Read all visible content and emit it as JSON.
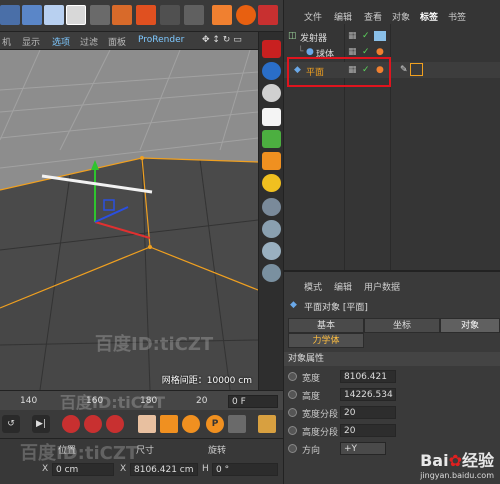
{
  "viewport_menu": {
    "items": [
      "机",
      "显示",
      "选项",
      "过滤",
      "面板",
      "ProRender"
    ]
  },
  "viewport": {
    "grid_label": "网格间距：10000 cm"
  },
  "object_manager": {
    "menu": [
      "文件",
      "编辑",
      "查看",
      "对象",
      "标签",
      "书签"
    ],
    "rows": [
      {
        "name": "发射器"
      },
      {
        "name": "球体"
      },
      {
        "name": "平面"
      }
    ]
  },
  "attribute_manager": {
    "menu": [
      "模式",
      "编辑",
      "用户数据"
    ],
    "title": "平面对象 [平面]",
    "tabs": [
      "基本",
      "坐标",
      "对象"
    ],
    "subtab": "力学体",
    "section": "对象属性",
    "properties": [
      {
        "label": "宽度",
        "value": "8106.421"
      },
      {
        "label": "高度",
        "value": "14226.534"
      },
      {
        "label": "宽度分段",
        "value": "20"
      },
      {
        "label": "高度分段",
        "value": "20"
      },
      {
        "label": "方向",
        "value": "+Y"
      }
    ]
  },
  "timeline": {
    "ticks": [
      "140",
      "160",
      "180",
      "20"
    ],
    "frame_field": "0 F"
  },
  "coords": {
    "headers": [
      "位置",
      "尺寸",
      "旋转"
    ],
    "x_label": "X",
    "pos_x": "0 cm",
    "size_x": "8106.421 cm",
    "h_label": "H",
    "rot_h": "0 °"
  },
  "watermarks": {
    "baidu_id": "百度ID:tiCZT",
    "baidu_logo": "Bai",
    "baidu_logo2": "经验",
    "baidu_url": "jingyan.baidu.com"
  },
  "colors": {
    "highlight": "#e0141e",
    "selection_orange": "#f0a020",
    "menu_active": "#7ec8ff"
  }
}
